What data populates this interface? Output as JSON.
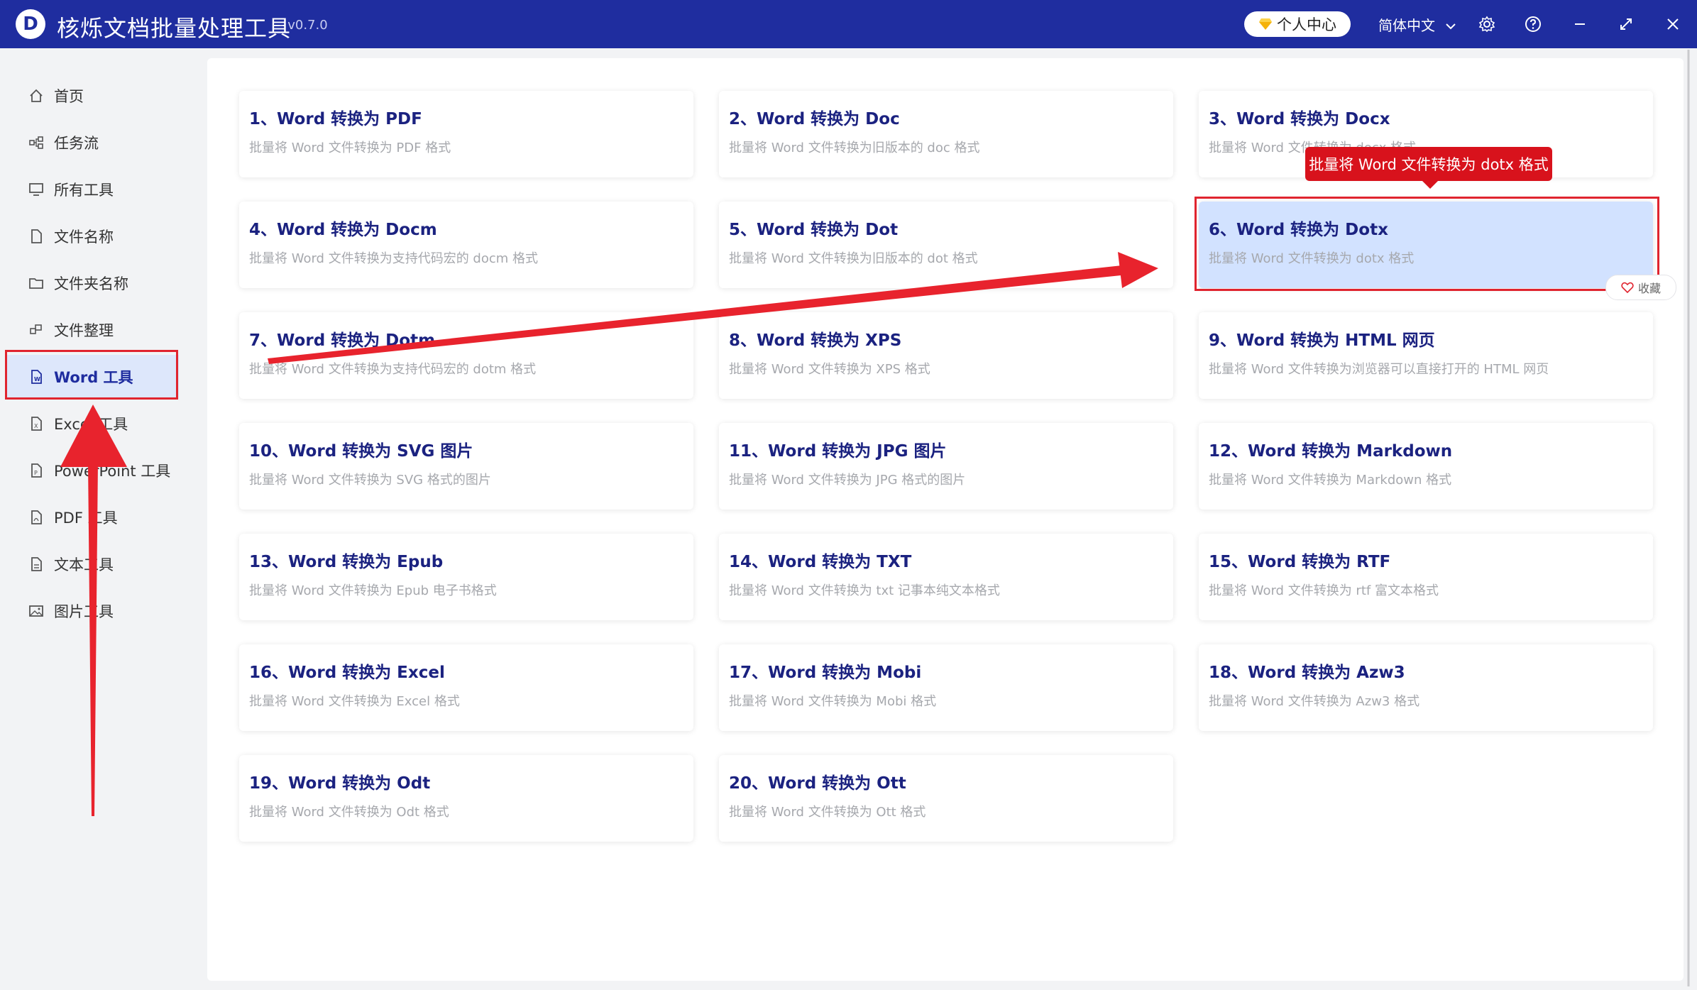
{
  "app": {
    "logo_letter": "D",
    "title": "核烁文档批量处理工具",
    "version": "- v0.7.0"
  },
  "titlebar": {
    "personal_center": "个人中心",
    "language": "简体中文"
  },
  "sidebar": {
    "items": [
      {
        "label": "首页",
        "icon": "home-icon"
      },
      {
        "label": "任务流",
        "icon": "workflow-icon"
      },
      {
        "label": "所有工具",
        "icon": "monitor-icon"
      },
      {
        "label": "文件名称",
        "icon": "file-icon"
      },
      {
        "label": "文件夹名称",
        "icon": "folder-icon"
      },
      {
        "label": "文件整理",
        "icon": "organize-icon"
      },
      {
        "label": "Word 工具",
        "icon": "word-file-icon",
        "active": true
      },
      {
        "label": "Excel 工具",
        "icon": "excel-file-icon"
      },
      {
        "label": "PowerPoint 工具",
        "icon": "ppt-file-icon"
      },
      {
        "label": "PDF 工具",
        "icon": "pdf-file-icon"
      },
      {
        "label": "文本工具",
        "icon": "text-file-icon"
      },
      {
        "label": "图片工具",
        "icon": "image-icon"
      }
    ]
  },
  "tools": [
    {
      "title": "1、Word 转换为 PDF",
      "desc": "批量将 Word 文件转换为 PDF 格式"
    },
    {
      "title": "2、Word 转换为 Doc",
      "desc": "批量将 Word 文件转换为旧版本的 doc 格式"
    },
    {
      "title": "3、Word 转换为 Docx",
      "desc": "批量将 Word 文件转换为 docx 格式"
    },
    {
      "title": "4、Word 转换为 Docm",
      "desc": "批量将 Word 文件转换为支持代码宏的 docm 格式"
    },
    {
      "title": "5、Word 转换为 Dot",
      "desc": "批量将 Word 文件转换为旧版本的 dot 格式"
    },
    {
      "title": "6、Word 转换为 Dotx",
      "desc": "批量将 Word 文件转换为 dotx 格式",
      "selected": true
    },
    {
      "title": "7、Word 转换为 Dotm",
      "desc": "批量将 Word 文件转换为支持代码宏的 dotm 格式"
    },
    {
      "title": "8、Word 转换为 XPS",
      "desc": "批量将 Word 文件转换为 XPS 格式"
    },
    {
      "title": "9、Word 转换为 HTML 网页",
      "desc": "批量将 Word 文件转换为浏览器可以直接打开的 HTML 网页"
    },
    {
      "title": "10、Word 转换为 SVG 图片",
      "desc": "批量将 Word 文件转换为 SVG 格式的图片"
    },
    {
      "title": "11、Word 转换为 JPG 图片",
      "desc": "批量将 Word 文件转换为 JPG 格式的图片"
    },
    {
      "title": "12、Word 转换为 Markdown",
      "desc": "批量将 Word 文件转换为 Markdown 格式"
    },
    {
      "title": "13、Word 转换为 Epub",
      "desc": "批量将 Word 文件转换为 Epub 电子书格式"
    },
    {
      "title": "14、Word 转换为 TXT",
      "desc": "批量将 Word 文件转换为 txt 记事本纯文本格式"
    },
    {
      "title": "15、Word 转换为 RTF",
      "desc": "批量将 Word 文件转换为 rtf 富文本格式"
    },
    {
      "title": "16、Word 转换为 Excel",
      "desc": "批量将 Word 文件转换为 Excel 格式"
    },
    {
      "title": "17、Word 转换为 Mobi",
      "desc": "批量将 Word 文件转换为 Mobi 格式"
    },
    {
      "title": "18、Word 转换为 Azw3",
      "desc": "批量将 Word 文件转换为 Azw3 格式"
    },
    {
      "title": "19、Word 转换为 Odt",
      "desc": "批量将 Word 文件转换为 Odt 格式"
    },
    {
      "title": "20、Word 转换为 Ott",
      "desc": "批量将 Word 文件转换为 Ott 格式"
    }
  ],
  "tooltip": "批量将 Word 文件转换为 dotx 格式",
  "favorite_label": "收藏",
  "colors": {
    "titlebar": "#1f2d9f",
    "card_title": "#1b2280",
    "annotation_red": "#e0242f",
    "selected_card": "#d2e2ff"
  }
}
